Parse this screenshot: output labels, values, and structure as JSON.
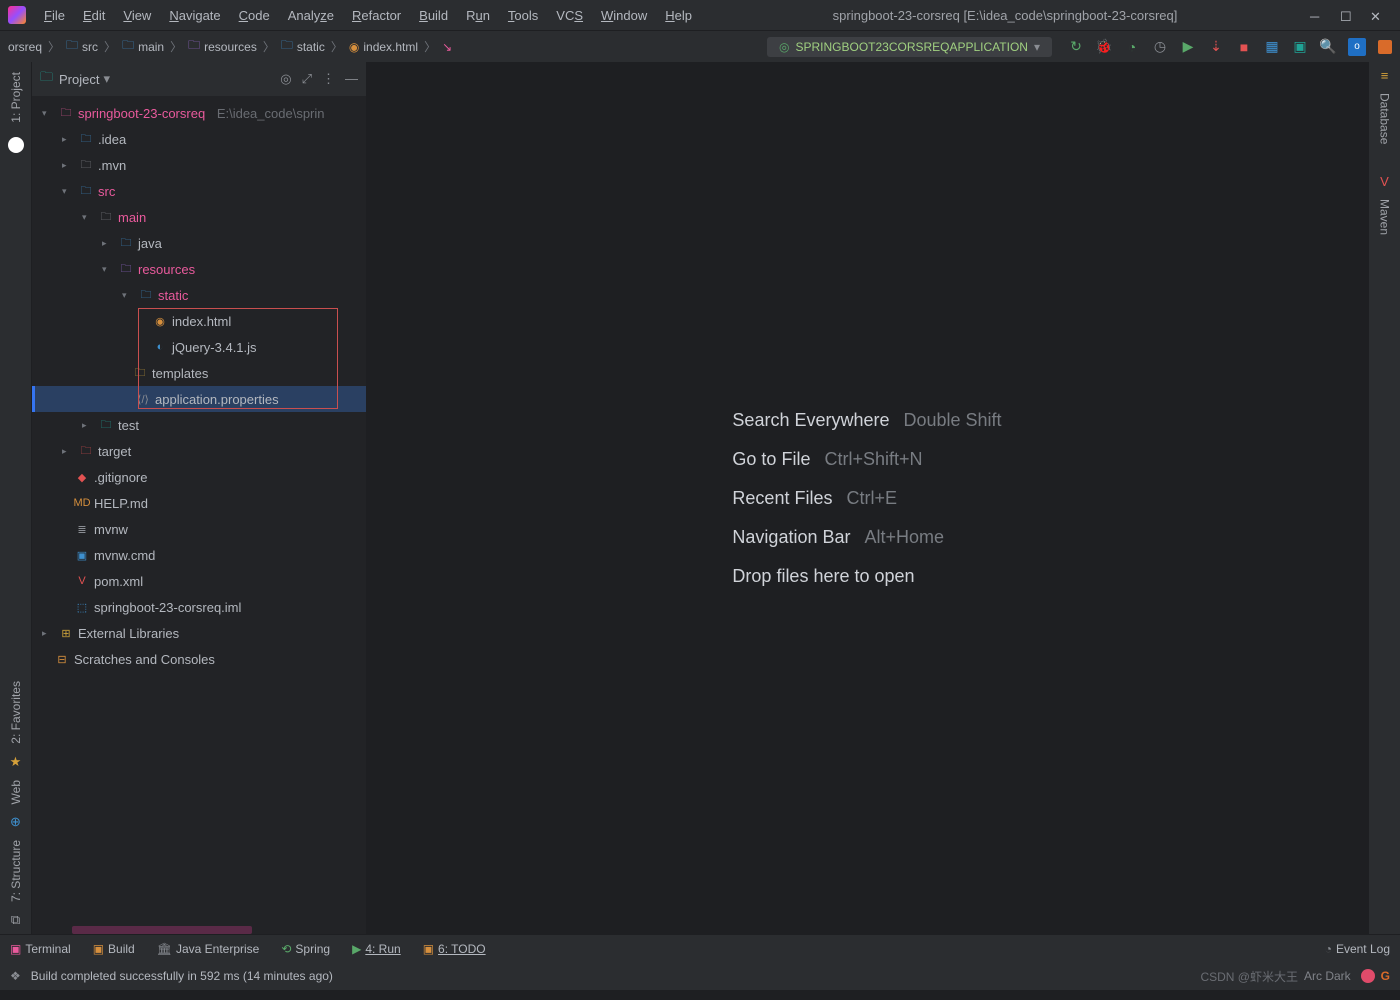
{
  "title": "springboot-23-corsreq [E:\\idea_code\\springboot-23-corsreq]",
  "menu": [
    "File",
    "Edit",
    "View",
    "Navigate",
    "Code",
    "Analyze",
    "Refactor",
    "Build",
    "Run",
    "Tools",
    "VCS",
    "Window",
    "Help"
  ],
  "breadcrumb": [
    "orsreq",
    "src",
    "main",
    "resources",
    "static",
    "index.html"
  ],
  "runconfig": "SPRINGBOOT23CORSREQAPPLICATION",
  "sidebar": {
    "title": "Project",
    "root": {
      "name": "springboot-23-corsreq",
      "path": "E:\\idea_code\\sprin"
    },
    "idea": ".idea",
    "mvn": ".mvn",
    "src": "src",
    "main": "main",
    "java": "java",
    "resources": "resources",
    "static": "static",
    "indexhtml": "index.html",
    "jquery": "jQuery-3.4.1.js",
    "templates": "templates",
    "appprops": "application.properties",
    "test": "test",
    "target": "target",
    "gitignore": ".gitignore",
    "help": "HELP.md",
    "mvnw": "mvnw",
    "mvnwcmd": "mvnw.cmd",
    "pom": "pom.xml",
    "iml": "springboot-23-corsreq.iml",
    "extlib": "External Libraries",
    "scratches": "Scratches and Consoles"
  },
  "hints": {
    "search": {
      "label": "Search Everywhere",
      "key": "Double Shift"
    },
    "goto": {
      "label": "Go to File",
      "key": "Ctrl+Shift+N"
    },
    "recent": {
      "label": "Recent Files",
      "key": "Ctrl+E"
    },
    "navbar": {
      "label": "Navigation Bar",
      "key": "Alt+Home"
    },
    "drop": "Drop files here to open"
  },
  "leftgutter": {
    "project": "1: Project",
    "favorites": "2: Favorites",
    "web": "Web",
    "structure": "7: Structure"
  },
  "rightgutter": {
    "database": "Database",
    "maven": "Maven"
  },
  "bottombar": {
    "terminal": "Terminal",
    "build": "Build",
    "javaee": "Java Enterprise",
    "spring": "Spring",
    "run": "4: Run",
    "todo": "6: TODO",
    "eventlog": "Event Log"
  },
  "statusbar": {
    "msg": "Build completed successfully in 592 ms (14 minutes ago)",
    "theme": "Arc Dark",
    "watermark": "CSDN @虾米大王"
  }
}
